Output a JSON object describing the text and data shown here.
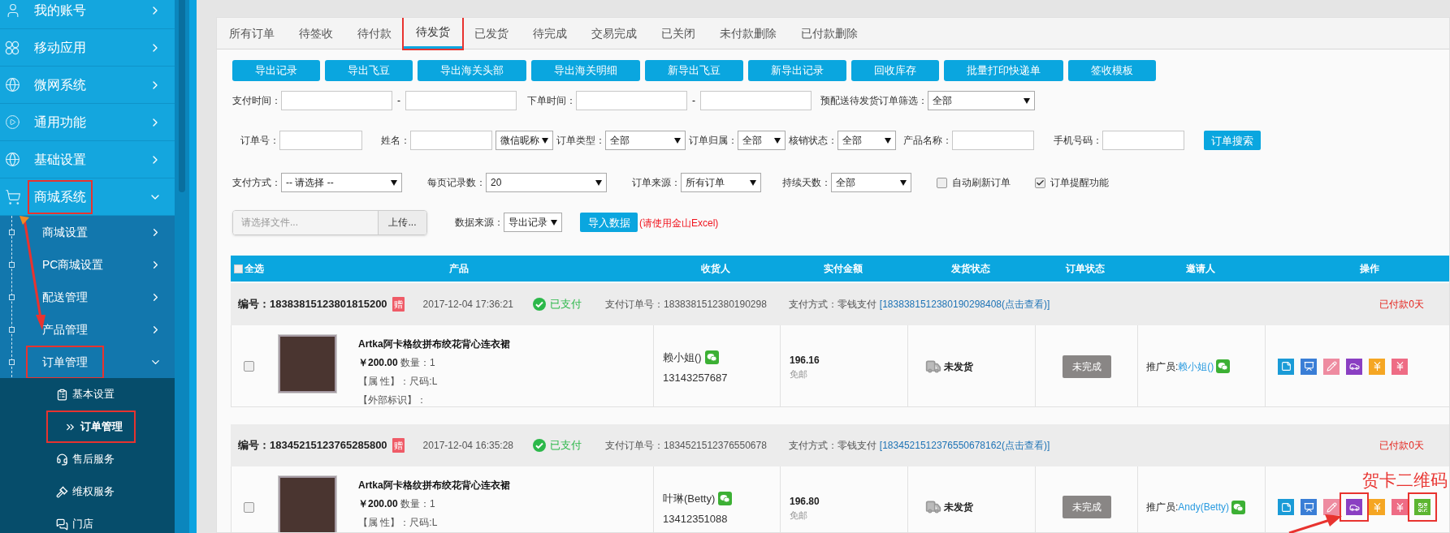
{
  "sidebar": {
    "items": [
      {
        "label": "我的账号",
        "expanded": false,
        "annotated": false
      },
      {
        "label": "移动应用",
        "expanded": false,
        "annotated": false
      },
      {
        "label": "微网系统",
        "expanded": false,
        "annotated": false
      },
      {
        "label": "通用功能",
        "expanded": false,
        "annotated": false
      },
      {
        "label": "基础设置",
        "expanded": false,
        "annotated": false
      },
      {
        "label": "商城系统",
        "expanded": true,
        "annotated": true,
        "children": [
          {
            "label": "商城设置",
            "expanded": false,
            "annotated": false
          },
          {
            "label": "PC商城设置",
            "expanded": false,
            "annotated": false
          },
          {
            "label": "配送管理",
            "expanded": false,
            "annotated": false
          },
          {
            "label": "产品管理",
            "expanded": false,
            "annotated": false
          },
          {
            "label": "订单管理",
            "expanded": true,
            "annotated": true,
            "children": [
              {
                "label": "基本设置",
                "selected": false,
                "annotated": false
              },
              {
                "label": "订单管理",
                "selected": true,
                "annotated": true
              },
              {
                "label": "售后服务",
                "selected": false,
                "annotated": false
              },
              {
                "label": "维权服务",
                "selected": false,
                "annotated": false
              },
              {
                "label": "门店",
                "selected": false,
                "annotated": false
              }
            ]
          }
        ]
      }
    ]
  },
  "tabs": [
    {
      "label": "所有订单",
      "selected": false,
      "annotated": false
    },
    {
      "label": "待签收",
      "selected": false,
      "annotated": false
    },
    {
      "label": "待付款",
      "selected": false,
      "annotated": false
    },
    {
      "label": "待发货",
      "selected": true,
      "annotated": true
    },
    {
      "label": "已发货",
      "selected": false,
      "annotated": false
    },
    {
      "label": "待完成",
      "selected": false,
      "annotated": false
    },
    {
      "label": "交易完成",
      "selected": false,
      "annotated": false
    },
    {
      "label": "已关闭",
      "selected": false,
      "annotated": false
    },
    {
      "label": "未付款删除",
      "selected": false,
      "annotated": false
    },
    {
      "label": "已付款删除",
      "selected": false,
      "annotated": false
    }
  ],
  "toolbar": [
    "导出记录",
    "导出飞豆",
    "导出海关头部",
    "导出海关明细",
    "新导出飞豆",
    "新导出记录",
    "回收库存",
    "批量打印快递单",
    "签收模板"
  ],
  "filters": [
    [
      {
        "kind": "range",
        "label": "支付时间：",
        "separator": "-"
      },
      {
        "kind": "range",
        "label": "下单时间：",
        "separator": "-"
      },
      {
        "kind": "select",
        "label": "预配送待发货订单筛选：",
        "value": "全部"
      }
    ],
    [
      {
        "kind": "input",
        "label": "订单号："
      },
      {
        "kind": "input",
        "label": "姓名："
      },
      {
        "kind": "select",
        "value": "微信昵称"
      },
      {
        "kind": "select",
        "label": "订单类型：",
        "value": "全部"
      },
      {
        "kind": "select",
        "label": "订单归属：",
        "value": "全部"
      },
      {
        "kind": "select",
        "label": "核销状态：",
        "value": "全部"
      },
      {
        "kind": "input",
        "label": "产品名称："
      },
      {
        "kind": "input",
        "label": "手机号码："
      },
      {
        "kind": "button",
        "label": "订单搜索"
      }
    ],
    [
      {
        "kind": "select",
        "label": "支付方式：",
        "value": "-- 请选择 --"
      },
      {
        "kind": "select",
        "label": "每页记录数：",
        "value": "20"
      },
      {
        "kind": "select",
        "label": "订单来源：",
        "value": "所有订单"
      },
      {
        "kind": "select",
        "label": "持续天数：",
        "value": "全部"
      },
      {
        "kind": "checkbox",
        "label": "自动刷新订单",
        "checked": false
      },
      {
        "kind": "checkbox",
        "label": "订单提醒功能",
        "checked": true
      }
    ],
    [
      {
        "kind": "file",
        "placeholder": "请选择文件...",
        "button": "上传..."
      },
      {
        "kind": "select",
        "label": "数据来源：",
        "value": "导出记录"
      },
      {
        "kind": "button",
        "label": "导入数据"
      },
      {
        "kind": "note",
        "label": "(请使用金山Excel)"
      }
    ]
  ],
  "table": {
    "select_all": {
      "label": "全选",
      "checked": false
    },
    "columns": [
      "产品",
      "收货人",
      "实付金额",
      "发货状态",
      "订单状态",
      "邀请人",
      "操作"
    ],
    "orders": [
      {
        "number_label": "编号：",
        "number": "18383815123801815200",
        "badge": "赠",
        "time": "2017-12-04 17:36:21",
        "paid": "已支付",
        "pay_order": "支付订单号：1838381512380190298",
        "pay_method": "支付方式：零钱支付",
        "pay_link": "[1838381512380190298408(点击查看)]",
        "days": "已付款0天",
        "selected": false,
        "product": {
          "name": "Artka阿卡格纹拼布绞花背心连衣裙",
          "price": "￥200.00",
          "qty": "数量：1",
          "attrs": [
            "【属 性】：尺码:L",
            "【外部标识】："
          ]
        },
        "receiver": {
          "name": "赖小姐()",
          "phone": "13143257687"
        },
        "amount": "196.16",
        "shipping": "免邮",
        "ship_status": "未发货",
        "order_status": "未完成",
        "inviter_label": "推广员:",
        "inviter": "赖小姐()",
        "actions": [
          {
            "kind": "note",
            "color": "#1a9bd7",
            "annotated": false
          },
          {
            "kind": "chart",
            "color": "#3a7ed6",
            "annotated": false
          },
          {
            "kind": "pencil",
            "color": "#ee8ba0",
            "annotated": false
          },
          {
            "kind": "car",
            "color": "#8a3fc2",
            "annotated": false
          },
          {
            "kind": "yen",
            "color": "#f5a623",
            "annotated": false
          },
          {
            "kind": "yen",
            "color": "#ee6c85",
            "annotated": false
          }
        ]
      },
      {
        "number_label": "编号：",
        "number": "18345215123765285800",
        "badge": "赠",
        "time": "2017-12-04 16:35:28",
        "paid": "已支付",
        "pay_order": "支付订单号：1834521512376550678",
        "pay_method": "支付方式：零钱支付",
        "pay_link": "[1834521512376550678162(点击查看)]",
        "days": "已付款0天",
        "selected": false,
        "product": {
          "name": "Artka阿卡格纹拼布绞花背心连衣裙",
          "price": "￥200.00",
          "qty": "数量：1",
          "attrs": [
            "【属 性】：尺码:L"
          ]
        },
        "receiver": {
          "name": "叶琳(Betty)",
          "phone": "13412351088"
        },
        "amount": "196.80",
        "shipping": "免邮",
        "ship_status": "未发货",
        "order_status": "未完成",
        "inviter_label": "推广员:",
        "inviter": "Andy(Betty)",
        "actions": [
          {
            "kind": "note",
            "color": "#1a9bd7",
            "annotated": false
          },
          {
            "kind": "chart",
            "color": "#3a7ed6",
            "annotated": false
          },
          {
            "kind": "pencil",
            "color": "#ee8ba0",
            "annotated": false
          },
          {
            "kind": "car",
            "color": "#8a3fc2",
            "annotated": true
          },
          {
            "kind": "yen",
            "color": "#f5a623",
            "annotated": false
          },
          {
            "kind": "yen",
            "color": "#ee6c85",
            "annotated": false
          },
          {
            "kind": "qr",
            "color": "#5cb531",
            "annotated": true
          }
        ]
      }
    ]
  },
  "annotation": {
    "label": "贺卡二维码"
  }
}
